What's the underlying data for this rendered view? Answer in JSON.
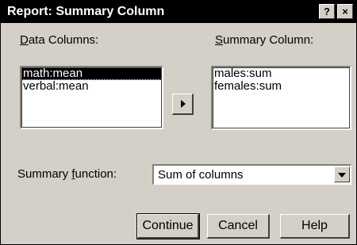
{
  "dialog": {
    "title": "Report: Summary Column",
    "help_glyph": "?",
    "close_glyph": "×"
  },
  "data_columns": {
    "label_accel": "D",
    "label_rest": "ata Columns:",
    "items": [
      "math:mean",
      "verbal:mean"
    ],
    "selected_index": 0
  },
  "summary_column": {
    "label_accel": "S",
    "label_rest": "ummary Column:",
    "items": [
      "males:sum",
      "females:sum"
    ]
  },
  "summary_function": {
    "label_pre": "Summary ",
    "label_accel": "f",
    "label_post": "unction:",
    "value": "Sum of columns"
  },
  "buttons": {
    "continue": "Continue",
    "cancel": "Cancel",
    "help": "Help"
  },
  "icons": {
    "move_right": "right-triangle-icon",
    "dropdown": "triangle-down-icon"
  }
}
